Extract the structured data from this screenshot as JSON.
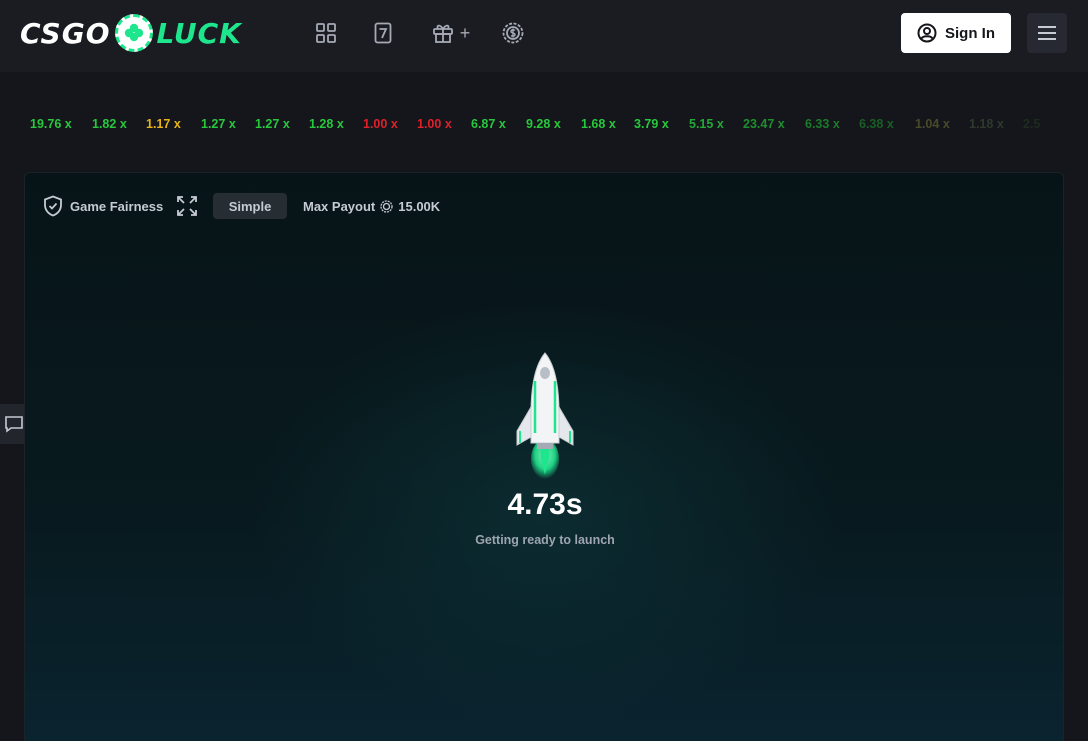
{
  "logo": {
    "part1": "CSGO",
    "part2": "LUCK"
  },
  "nav": {
    "icons": [
      "grid-icon",
      "slot-seven-icon",
      "gift-icon",
      "coin-icon"
    ],
    "gift_plus": "+",
    "slot_label": "7"
  },
  "header": {
    "signin_label": "Sign In"
  },
  "history": [
    {
      "value": "19.76",
      "suffix": "x",
      "color": "#28c83c"
    },
    {
      "value": "1.82",
      "suffix": "x",
      "color": "#28c83c"
    },
    {
      "value": "1.17",
      "suffix": "x",
      "color": "#e6b419"
    },
    {
      "value": "1.27",
      "suffix": "x",
      "color": "#28c83c"
    },
    {
      "value": "1.27",
      "suffix": "x",
      "color": "#28c83c"
    },
    {
      "value": "1.28",
      "suffix": "x",
      "color": "#28c83c"
    },
    {
      "value": "1.00",
      "suffix": "x",
      "color": "#e0202a"
    },
    {
      "value": "1.00",
      "suffix": "x",
      "color": "#e0202a"
    },
    {
      "value": "6.87",
      "suffix": "x",
      "color": "#28c83c"
    },
    {
      "value": "9.28",
      "suffix": "x",
      "color": "#28c83c"
    },
    {
      "value": "1.68",
      "suffix": "x",
      "color": "#28c83c"
    },
    {
      "value": "3.79",
      "suffix": "x",
      "color": "#28c83c"
    },
    {
      "value": "5.15",
      "suffix": "x",
      "color": "#23a837"
    },
    {
      "value": "23.47",
      "suffix": "x",
      "color": "#1e8f2f"
    },
    {
      "value": "6.33",
      "suffix": "x",
      "color": "#1c7a2a"
    },
    {
      "value": "6.38",
      "suffix": "x",
      "color": "#195f25"
    },
    {
      "value": "1.04",
      "suffix": "x",
      "color": "#4a4a2a"
    },
    {
      "value": "1.18",
      "suffix": "x",
      "color": "#2e3a2c"
    },
    {
      "value": "2.5",
      "suffix": "",
      "color": "#1f2a20"
    }
  ],
  "panel": {
    "fairness_label": "Game Fairness",
    "mode_label": "Simple",
    "max_payout_label": "Max Payout",
    "max_payout_value": "15.00K",
    "timer": "4.73s",
    "status": "Getting ready to launch"
  },
  "colors": {
    "accent": "#1ee68c",
    "loss": "#e0202a",
    "win": "#28c83c",
    "warn": "#e6b419"
  }
}
